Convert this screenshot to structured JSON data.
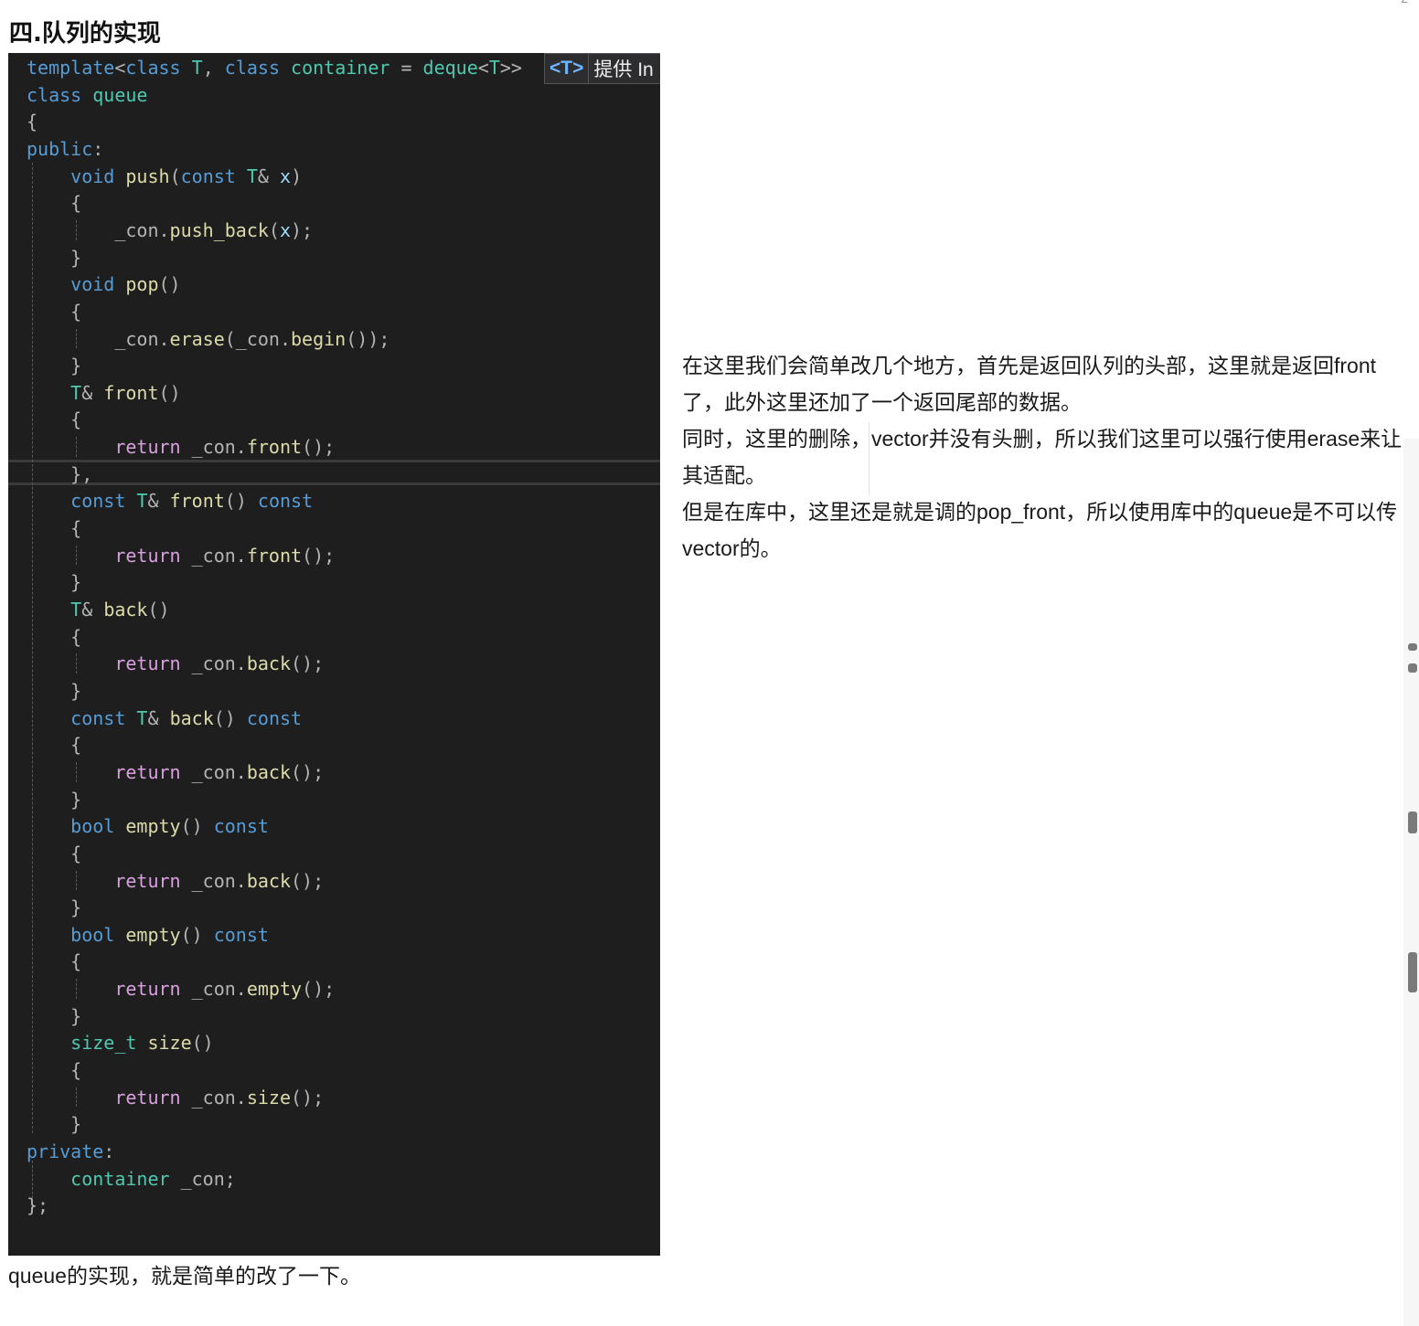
{
  "heading": "四.队列的实现",
  "top_marker": "2",
  "hint": {
    "badge": "<T>",
    "text": "提供 In"
  },
  "code_lines": [
    [
      [
        "kw",
        "template"
      ],
      [
        "pu",
        "<"
      ],
      [
        "kw",
        "class"
      ],
      [
        "ty",
        " T"
      ],
      [
        "pu",
        ", "
      ],
      [
        "kw",
        "class"
      ],
      [
        "ty",
        " container"
      ],
      [
        "pu",
        " = "
      ],
      [
        "ty",
        "deque"
      ],
      [
        "pu",
        "<"
      ],
      [
        "ty",
        "T"
      ],
      [
        "pu",
        ">>"
      ]
    ],
    [
      [
        "kw",
        "class"
      ],
      [
        "ty",
        " queue"
      ]
    ],
    [
      [
        "pu",
        "{"
      ]
    ],
    [
      [
        "kw",
        "public"
      ],
      [
        "pu",
        ":"
      ]
    ],
    [
      [
        "pu",
        "    "
      ],
      [
        "kw",
        "void"
      ],
      [
        "fn",
        " push"
      ],
      [
        "pu",
        "("
      ],
      [
        "kw",
        "const"
      ],
      [
        "ty",
        " T"
      ],
      [
        "pu",
        "& "
      ],
      [
        "pr",
        "x"
      ],
      [
        "pu",
        ")"
      ]
    ],
    [
      [
        "pu",
        "    {"
      ]
    ],
    [
      [
        "pu",
        "        _con."
      ],
      [
        "fn",
        "push_back"
      ],
      [
        "pu",
        "("
      ],
      [
        "pr",
        "x"
      ],
      [
        "pu",
        ");"
      ]
    ],
    [
      [
        "pu",
        "    }"
      ]
    ],
    [
      [
        "pu",
        "    "
      ],
      [
        "kw",
        "void"
      ],
      [
        "fn",
        " pop"
      ],
      [
        "pu",
        "()"
      ]
    ],
    [
      [
        "pu",
        "    {"
      ]
    ],
    [
      [
        "pu",
        "        _con."
      ],
      [
        "fn",
        "erase"
      ],
      [
        "pu",
        "(_con."
      ],
      [
        "fn",
        "begin"
      ],
      [
        "pu",
        "());"
      ]
    ],
    [
      [
        "pu",
        "    }"
      ]
    ],
    [
      [
        "pu",
        "    "
      ],
      [
        "ty",
        "T"
      ],
      [
        "pu",
        "& "
      ],
      [
        "fn",
        "front"
      ],
      [
        "pu",
        "()"
      ]
    ],
    [
      [
        "pu",
        "    {"
      ]
    ],
    [
      [
        "pu",
        "        "
      ],
      [
        "rt",
        "return"
      ],
      [
        "pu",
        " _con."
      ],
      [
        "fn",
        "front"
      ],
      [
        "pu",
        "();"
      ]
    ],
    [
      [
        "pu",
        "    },"
      ]
    ],
    [
      [
        "pu",
        "    "
      ],
      [
        "kw",
        "const"
      ],
      [
        "ty",
        " T"
      ],
      [
        "pu",
        "& "
      ],
      [
        "fn",
        "front"
      ],
      [
        "pu",
        "() "
      ],
      [
        "kw",
        "const"
      ]
    ],
    [
      [
        "pu",
        "    {"
      ]
    ],
    [
      [
        "pu",
        "        "
      ],
      [
        "rt",
        "return"
      ],
      [
        "pu",
        " _con."
      ],
      [
        "fn",
        "front"
      ],
      [
        "pu",
        "();"
      ]
    ],
    [
      [
        "pu",
        "    }"
      ]
    ],
    [
      [
        "pu",
        "    "
      ],
      [
        "ty",
        "T"
      ],
      [
        "pu",
        "& "
      ],
      [
        "fn",
        "back"
      ],
      [
        "pu",
        "()"
      ]
    ],
    [
      [
        "pu",
        "    {"
      ]
    ],
    [
      [
        "pu",
        "        "
      ],
      [
        "rt",
        "return"
      ],
      [
        "pu",
        " _con."
      ],
      [
        "fn",
        "back"
      ],
      [
        "pu",
        "();"
      ]
    ],
    [
      [
        "pu",
        "    }"
      ]
    ],
    [
      [
        "pu",
        "    "
      ],
      [
        "kw",
        "const"
      ],
      [
        "ty",
        " T"
      ],
      [
        "pu",
        "& "
      ],
      [
        "fn",
        "back"
      ],
      [
        "pu",
        "() "
      ],
      [
        "kw",
        "const"
      ]
    ],
    [
      [
        "pu",
        "    {"
      ]
    ],
    [
      [
        "pu",
        "        "
      ],
      [
        "rt",
        "return"
      ],
      [
        "pu",
        " _con."
      ],
      [
        "fn",
        "back"
      ],
      [
        "pu",
        "();"
      ]
    ],
    [
      [
        "pu",
        "    }"
      ]
    ],
    [
      [
        "pu",
        "    "
      ],
      [
        "kw",
        "bool"
      ],
      [
        "fn",
        " empty"
      ],
      [
        "pu",
        "() "
      ],
      [
        "kw",
        "const"
      ]
    ],
    [
      [
        "pu",
        "    {"
      ]
    ],
    [
      [
        "pu",
        "        "
      ],
      [
        "rt",
        "return"
      ],
      [
        "pu",
        " _con."
      ],
      [
        "fn",
        "back"
      ],
      [
        "pu",
        "();"
      ]
    ],
    [
      [
        "pu",
        "    }"
      ]
    ],
    [
      [
        "pu",
        "    "
      ],
      [
        "kw",
        "bool"
      ],
      [
        "fn",
        " empty"
      ],
      [
        "pu",
        "() "
      ],
      [
        "kw",
        "const"
      ]
    ],
    [
      [
        "pu",
        "    {"
      ]
    ],
    [
      [
        "pu",
        "        "
      ],
      [
        "rt",
        "return"
      ],
      [
        "pu",
        " _con."
      ],
      [
        "fn",
        "empty"
      ],
      [
        "pu",
        "();"
      ]
    ],
    [
      [
        "pu",
        "    }"
      ]
    ],
    [
      [
        "pu",
        "    "
      ],
      [
        "ty",
        "size_t"
      ],
      [
        "fn",
        " size"
      ],
      [
        "pu",
        "()"
      ]
    ],
    [
      [
        "pu",
        "    {"
      ]
    ],
    [
      [
        "pu",
        "        "
      ],
      [
        "rt",
        "return"
      ],
      [
        "pu",
        " _con."
      ],
      [
        "fn",
        "size"
      ],
      [
        "pu",
        "();"
      ]
    ],
    [
      [
        "pu",
        "    }"
      ]
    ],
    [
      [
        "kw",
        "private"
      ],
      [
        "pu",
        ":"
      ]
    ],
    [
      [
        "pu",
        "    "
      ],
      [
        "ty",
        "container"
      ],
      [
        "pu",
        " _con;"
      ]
    ],
    [
      [
        "pu",
        "};"
      ]
    ]
  ],
  "explanation": [
    "在这里我们会简单改几个地方，首先是返回队列的头部，这里就是返回front了，此外这里还加了一个返回尾部的数据。",
    "同时，这里的删除，vector并没有头删，所以我们这里可以强行使用erase来让其适配。",
    "但是在库中，这里还是就是调的pop_front，所以使用库中的queue是不可以传vector的。"
  ],
  "caption": "queue的实现，就是简单的改了一下。"
}
